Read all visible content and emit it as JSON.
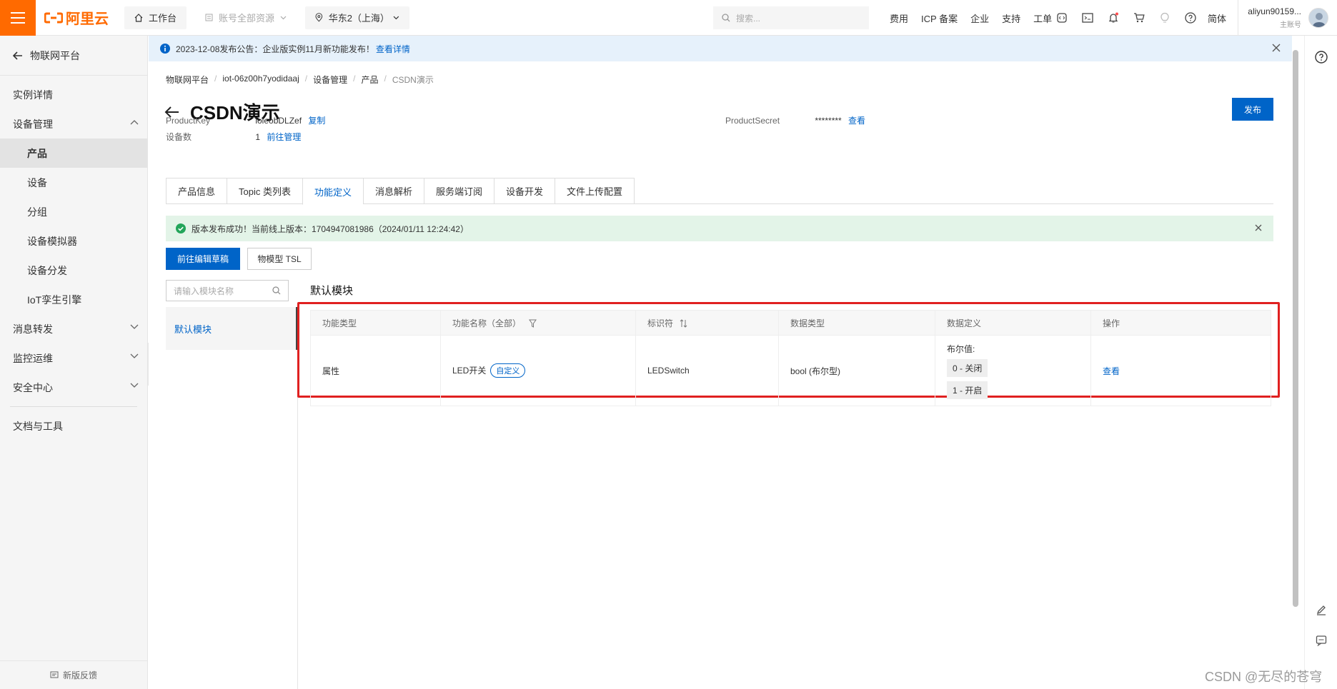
{
  "topbar": {
    "logo_text": "阿里云",
    "workbench": "工作台",
    "resources": "账号全部资源",
    "region": "华东2（上海）",
    "search_placeholder": "搜索...",
    "links": [
      "费用",
      "ICP 备案",
      "企业",
      "支持",
      "工单"
    ],
    "lang": "简体",
    "user_name": "aliyun90159...",
    "user_role": "主账号"
  },
  "sidebar": {
    "back_label": "物联网平台",
    "items": [
      {
        "label": "实例详情",
        "level": 1
      },
      {
        "label": "设备管理",
        "level": 1,
        "expanded": true
      },
      {
        "label": "产品",
        "level": 2,
        "active": true
      },
      {
        "label": "设备",
        "level": 2
      },
      {
        "label": "分组",
        "level": 2
      },
      {
        "label": "设备模拟器",
        "level": 2
      },
      {
        "label": "设备分发",
        "level": 2
      },
      {
        "label": "IoT孪生引擎",
        "level": 2
      },
      {
        "label": "消息转发",
        "level": 1
      },
      {
        "label": "监控运维",
        "level": 1
      },
      {
        "label": "安全中心",
        "level": 1
      },
      {
        "label": "文档与工具",
        "level": 1
      }
    ],
    "feedback": "新版反馈"
  },
  "notice": {
    "text": "2023-12-08发布公告：企业版实例11月新功能发布！",
    "link": "查看详情"
  },
  "breadcrumb": [
    "物联网平台",
    "iot-06z00h7yodidaaj",
    "设备管理",
    "产品",
    "CSDN演示"
  ],
  "page": {
    "title": "CSDN演示",
    "publish": "发布",
    "product_key_label": "ProductKey",
    "product_key": "ioieobDLZef",
    "copy": "复制",
    "device_count_label": "设备数",
    "device_count": "1",
    "manage": "前往管理",
    "product_secret_label": "ProductSecret",
    "product_secret": "********",
    "view": "查看"
  },
  "tabs": [
    "产品信息",
    "Topic 类列表",
    "功能定义",
    "消息解析",
    "服务端订阅",
    "设备开发",
    "文件上传配置"
  ],
  "active_tab": 2,
  "success_msg": "版本发布成功！当前线上版本：1704947081986（2024/01/11 12:24:42）",
  "buttons": {
    "edit_draft": "前往编辑草稿",
    "tsl": "物模型 TSL"
  },
  "modules": {
    "search_placeholder": "请输入模块名称",
    "items": [
      "默认模块"
    ],
    "title": "默认模块"
  },
  "table": {
    "headers": [
      "功能类型",
      "功能名称（全部）",
      "标识符",
      "数据类型",
      "数据定义",
      "操作"
    ],
    "row": {
      "type": "属性",
      "name": "LED开关",
      "tag": "自定义",
      "identifier": "LEDSwitch",
      "datatype": "bool (布尔型)",
      "def_label": "布尔值:",
      "def_values": [
        "0 - 关闭",
        "1 - 开启"
      ],
      "action": "查看"
    }
  },
  "watermark": "CSDN @无尽的苍穹",
  "colors": {
    "brand": "#ff6a00",
    "primary": "#0064c8",
    "highlight": "#e02020",
    "success_bg": "#e3f4e8"
  }
}
